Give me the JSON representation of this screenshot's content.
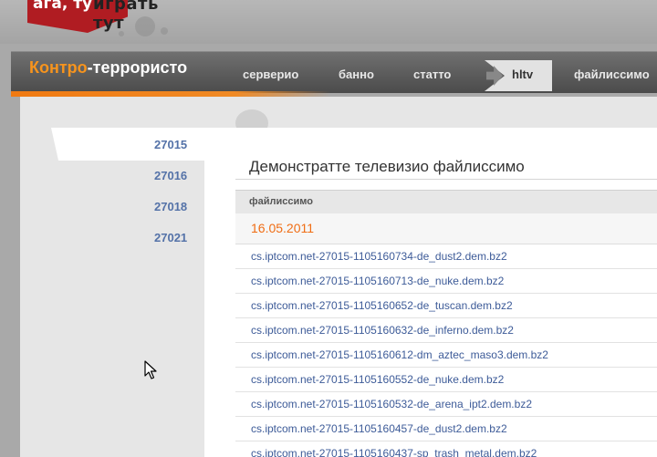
{
  "logo": {
    "part1": "ага, ту",
    "part2": "играть тут"
  },
  "site": {
    "title_part1": "Контро",
    "title_part2": "-террористо"
  },
  "nav": {
    "items": [
      "серверио",
      "банно",
      "статто"
    ],
    "active": "hltv",
    "last": "файлиссимо"
  },
  "sidebar": {
    "items": [
      "27015",
      "27016",
      "27018",
      "27021"
    ]
  },
  "content": {
    "title": "Демонстратте телевизио файлиссимо",
    "column_header": "файлиссимо",
    "date": "16.05.2011",
    "files": [
      "cs.iptcom.net-27015-1105160734-de_dust2.dem.bz2",
      "cs.iptcom.net-27015-1105160713-de_nuke.dem.bz2",
      "cs.iptcom.net-27015-1105160652-de_tuscan.dem.bz2",
      "cs.iptcom.net-27015-1105160632-de_inferno.dem.bz2",
      "cs.iptcom.net-27015-1105160612-dm_aztec_maso3.dem.bz2",
      "cs.iptcom.net-27015-1105160552-de_nuke.dem.bz2",
      "cs.iptcom.net-27015-1105160532-de_arena_ipt2.dem.bz2",
      "cs.iptcom.net-27015-1105160457-de_dust2.dem.bz2",
      "cs.iptcom.net-27015-1105160437-sp_trash_metal.dem.bz2"
    ]
  },
  "colors": {
    "accent": "#f7941d",
    "link": "#3d5b98",
    "brand_red": "#b01c22"
  }
}
